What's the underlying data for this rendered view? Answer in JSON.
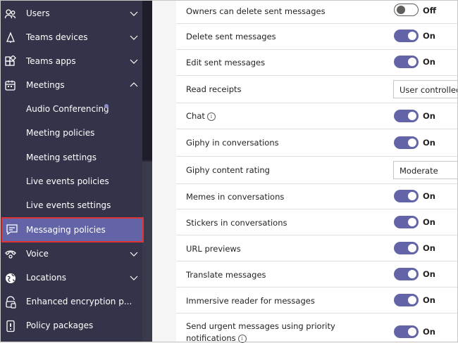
{
  "sidebar": {
    "items": [
      {
        "label": "Users",
        "icon": "users-icon",
        "chevron": "down"
      },
      {
        "label": "Teams devices",
        "icon": "devices-icon",
        "chevron": "down"
      },
      {
        "label": "Teams apps",
        "icon": "apps-icon",
        "chevron": "down"
      },
      {
        "label": "Meetings",
        "icon": "calendar-icon",
        "chevron": "up"
      },
      {
        "label": "Audio Conferencing"
      },
      {
        "label": "Meeting policies"
      },
      {
        "label": "Meeting settings"
      },
      {
        "label": "Live events policies"
      },
      {
        "label": "Live events settings"
      },
      {
        "label": "Messaging policies",
        "icon": "message-icon",
        "active": true
      },
      {
        "label": "Voice",
        "icon": "phone-icon",
        "chevron": "down"
      },
      {
        "label": "Locations",
        "icon": "globe-icon",
        "chevron": "down"
      },
      {
        "label": "Enhanced encryption p...",
        "icon": "lock-icon"
      },
      {
        "label": "Policy packages",
        "icon": "package-icon"
      }
    ]
  },
  "settings": [
    {
      "label": "Owners can delete sent messages",
      "type": "toggle",
      "state": "Off"
    },
    {
      "label": "Delete sent messages",
      "type": "toggle",
      "state": "On"
    },
    {
      "label": "Edit sent messages",
      "type": "toggle",
      "state": "On"
    },
    {
      "label": "Read receipts",
      "type": "select",
      "value": "User controlled"
    },
    {
      "label": "Chat",
      "type": "toggle",
      "state": "On",
      "info": true
    },
    {
      "label": "Giphy in conversations",
      "type": "toggle",
      "state": "On"
    },
    {
      "label": "Giphy content rating",
      "type": "select",
      "value": "Moderate"
    },
    {
      "label": "Memes in conversations",
      "type": "toggle",
      "state": "On"
    },
    {
      "label": "Stickers in conversations",
      "type": "toggle",
      "state": "On"
    },
    {
      "label": "URL previews",
      "type": "toggle",
      "state": "On"
    },
    {
      "label": "Translate messages",
      "type": "toggle",
      "state": "On"
    },
    {
      "label": "Immersive reader for messages",
      "type": "toggle",
      "state": "On"
    },
    {
      "label_line1": "Send urgent messages using priority",
      "label_line2": "notifications",
      "type": "toggle",
      "state": "On",
      "info": true
    }
  ],
  "colors": {
    "accent": "#6264a7",
    "sidebar": "#33344a",
    "highlight_border": "#e03434"
  }
}
